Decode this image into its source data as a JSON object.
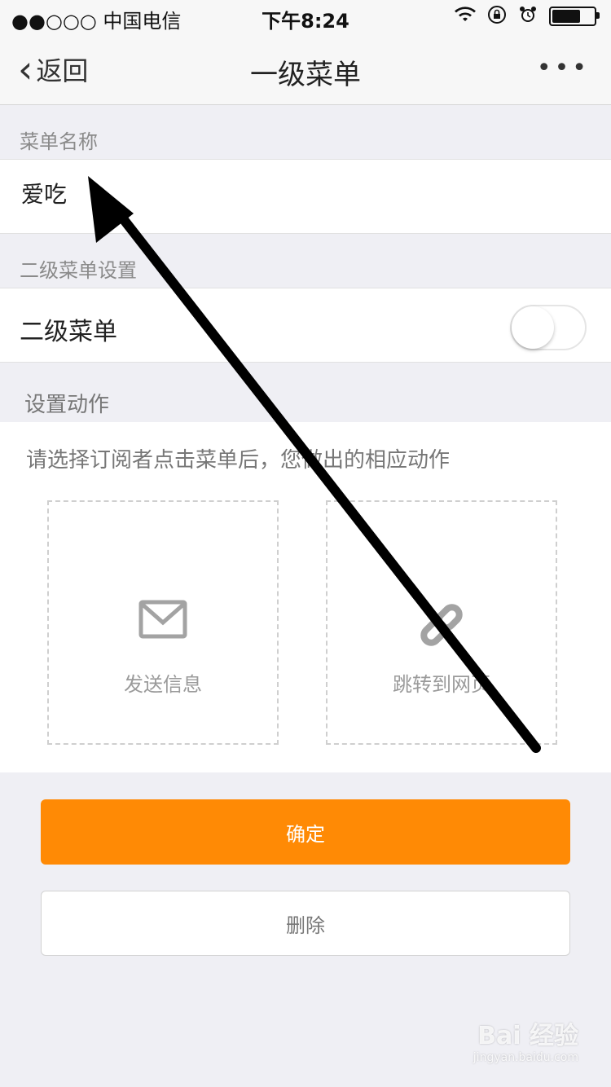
{
  "status_bar": {
    "carrier": "●●○○○ 中国电信",
    "time": "下午8:24",
    "battery_level": 0.7
  },
  "nav": {
    "back_label": "返回",
    "title": "一级菜单",
    "more_label": "•••"
  },
  "menu_name": {
    "section_label": "菜单名称",
    "value": "爱吃"
  },
  "submenu": {
    "section_label": "二级菜单设置",
    "row_label": "二级菜单",
    "enabled": false
  },
  "action": {
    "section_label": "设置动作",
    "description": "请选择订阅者点击菜单后，您做出的相应动作",
    "options": [
      {
        "label": "发送信息",
        "icon": "envelope-icon"
      },
      {
        "label": "跳转到网页",
        "icon": "link-icon"
      }
    ]
  },
  "buttons": {
    "confirm": "确定",
    "delete": "删除"
  },
  "watermark": {
    "brand": "Bai 经验",
    "url": "jingyan.baidu.com"
  },
  "colors": {
    "accent": "#ff8a05",
    "background": "#efeff4"
  }
}
